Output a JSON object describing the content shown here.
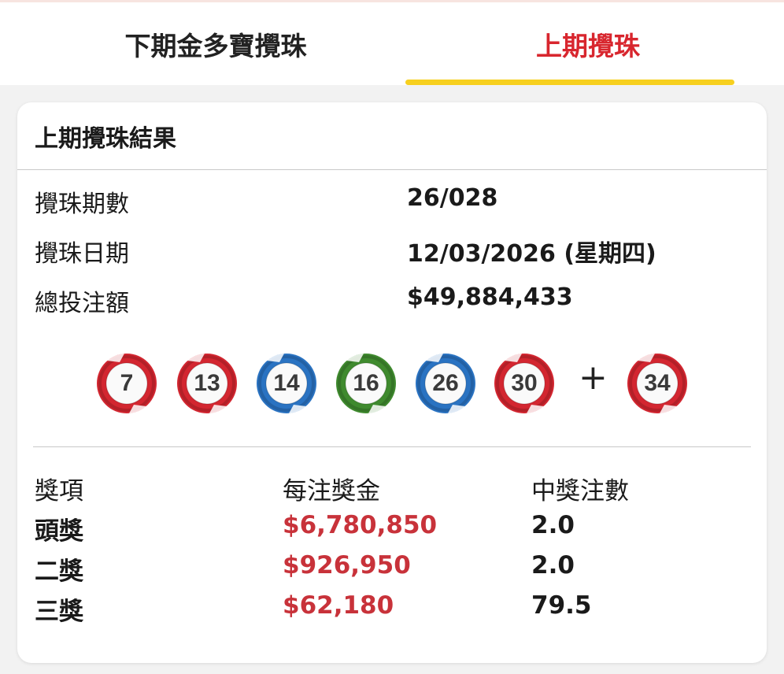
{
  "tabs": [
    {
      "label": "下期金多寶攪珠",
      "active": false
    },
    {
      "label": "上期攪珠",
      "active": true
    }
  ],
  "colors": {
    "active_tab": "#d8262e",
    "underline": "#f7d01f",
    "prize_amount": "#c8323a",
    "ball_red": "#d32630",
    "ball_blue": "#2a73c2",
    "ball_green": "#3f8a2e"
  },
  "card": {
    "title": "上期攪珠結果",
    "draw_number_label": "攪珠期數",
    "draw_number": "26/028",
    "draw_date_label": "攪珠日期",
    "draw_date": "12/03/2026 (星期四)",
    "turnover_label": "總投注額",
    "turnover": "$49,884,433"
  },
  "balls": [
    {
      "number": "7",
      "color": "red"
    },
    {
      "number": "13",
      "color": "red"
    },
    {
      "number": "14",
      "color": "blue"
    },
    {
      "number": "16",
      "color": "green"
    },
    {
      "number": "26",
      "color": "blue"
    },
    {
      "number": "30",
      "color": "red"
    }
  ],
  "plus_sign": "+",
  "extra_ball": {
    "number": "34",
    "color": "red"
  },
  "prize_table": {
    "headers": [
      "獎項",
      "每注獎金",
      "中獎注數"
    ],
    "rows": [
      {
        "name": "頭獎",
        "amount": "$6,780,850",
        "winners": "2.0"
      },
      {
        "name": "二獎",
        "amount": "$926,950",
        "winners": "2.0"
      },
      {
        "name": "三獎",
        "amount": "$62,180",
        "winners": "79.5"
      }
    ]
  }
}
